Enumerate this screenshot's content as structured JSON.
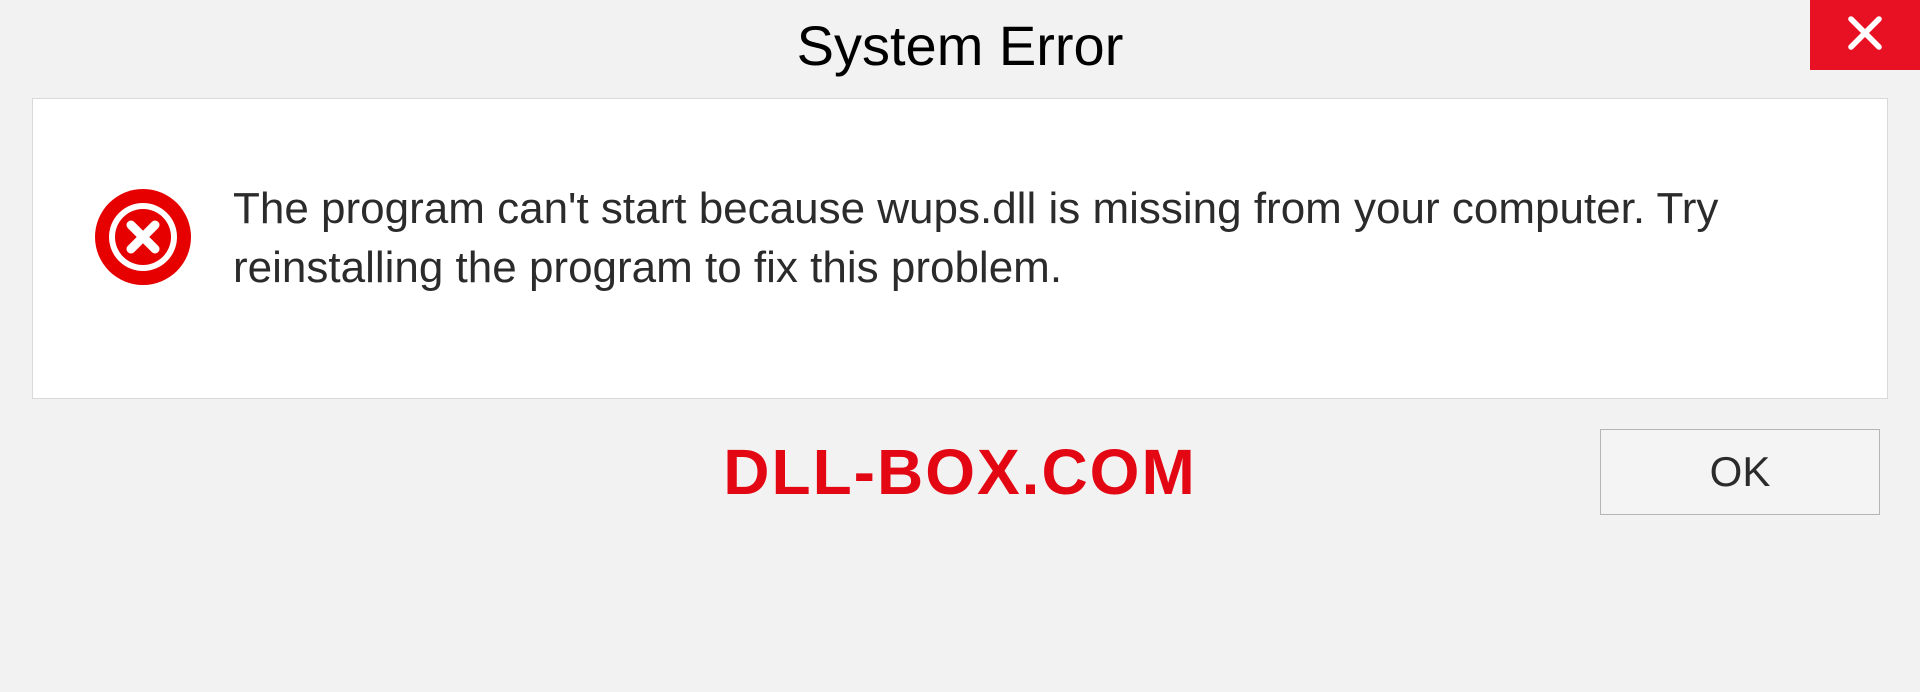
{
  "dialog": {
    "title": "System Error",
    "message": "The program can't start because wups.dll is missing from your computer. Try reinstalling the program to fix this problem.",
    "ok_label": "OK"
  },
  "watermark": "DLL-BOX.COM",
  "icons": {
    "close": "close-icon",
    "error": "error-circle-x-icon"
  },
  "colors": {
    "close_bg": "#e81123",
    "error_icon": "#e60000",
    "watermark": "#e30613",
    "panel_bg": "#f2f2f2"
  }
}
